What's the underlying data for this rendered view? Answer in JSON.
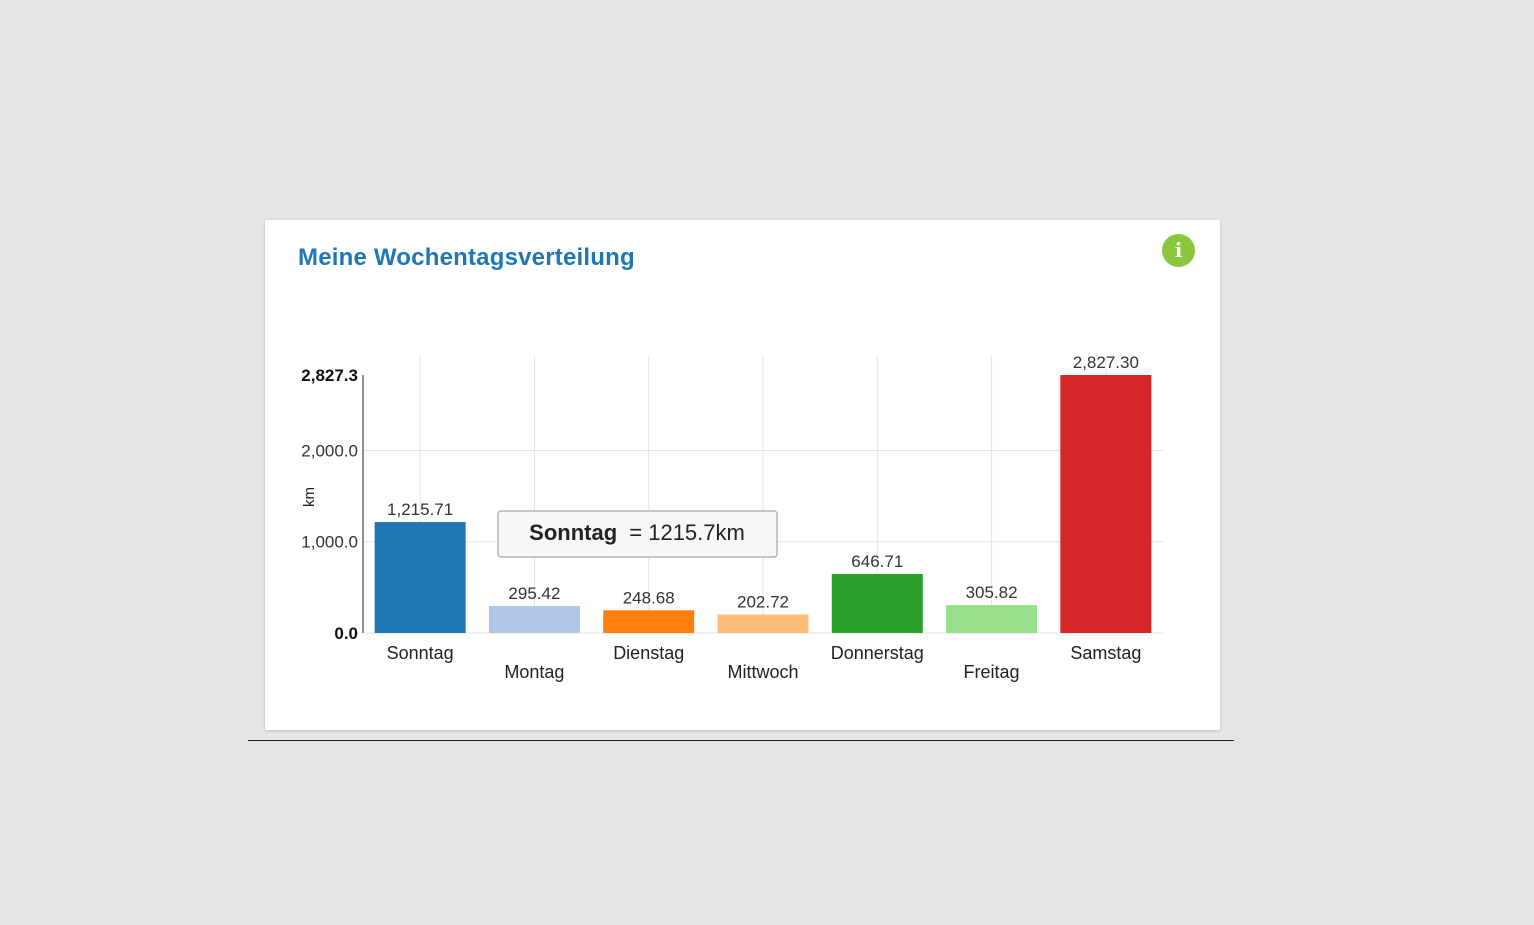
{
  "card": {
    "title": "Meine Wochentagsverteilung",
    "info_icon": "info-icon",
    "info_symbol": "i",
    "info_color": "#8cc63f"
  },
  "chart_data": {
    "type": "bar",
    "title": "",
    "xlabel": "",
    "ylabel": "km",
    "ylim": [
      0,
      2827.3
    ],
    "y_ticks": [
      "0.0",
      "1,000.0",
      "2,000.0",
      "2,827.3"
    ],
    "y_tick_values": [
      0,
      1000,
      2000,
      2827.3
    ],
    "grid": true,
    "categories": [
      "Sonntag",
      "Montag",
      "Dienstag",
      "Mittwoch",
      "Donnerstag",
      "Freitag",
      "Samstag"
    ],
    "values": [
      1215.71,
      295.42,
      248.68,
      202.72,
      646.71,
      305.82,
      2827.3
    ],
    "value_labels": [
      "1,215.71",
      "295.42",
      "248.68",
      "202.72",
      "646.71",
      "305.82",
      "2,827.30"
    ],
    "colors": [
      "#1f77b4",
      "#aec7e8",
      "#ff7f0e",
      "#ffbb78",
      "#2ca02c",
      "#98df8a",
      "#d62728"
    ],
    "tooltip": {
      "category": "Sonntag",
      "text": "= 1215.7km"
    }
  }
}
